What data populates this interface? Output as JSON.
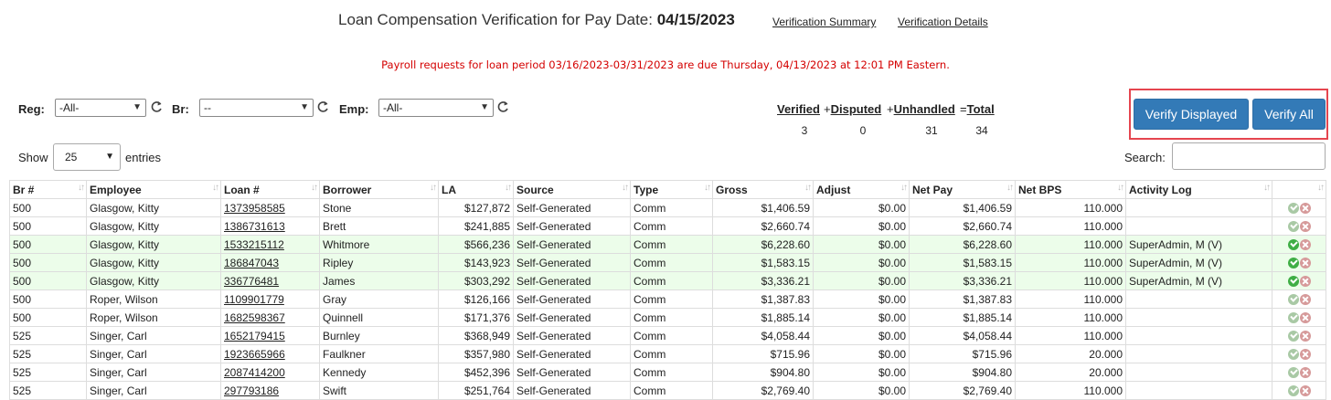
{
  "header": {
    "title_prefix": "Loan Compensation Verification for Pay Date: ",
    "pay_date": "04/15/2023",
    "link_summary": "Verification Summary",
    "link_details": "Verification Details"
  },
  "notice": "Payroll requests for loan period 03/16/2023-03/31/2023 are due Thursday, 04/13/2023 at 12:01 PM Eastern.",
  "filters": {
    "reg_label": "Reg:",
    "reg_value": "-All-",
    "br_label": "Br:",
    "br_value": "--",
    "emp_label": "Emp:",
    "emp_value": "-All-"
  },
  "stats": {
    "verified_label": "Verified",
    "disputed_prefix": "+",
    "disputed_label": "Disputed",
    "unhandled_prefix": "+",
    "unhandled_label": "Unhandled",
    "total_prefix": "=",
    "total_label": "Total",
    "verified": "3",
    "disputed": "0",
    "unhandled": "31",
    "total": "34"
  },
  "buttons": {
    "verify_displayed": "Verify Displayed",
    "verify_all": "Verify All"
  },
  "table_controls": {
    "show": "Show",
    "page_length": "25",
    "entries": "entries",
    "search_label": "Search:"
  },
  "columns": [
    "Br #",
    "Employee",
    "Loan #",
    "Borrower",
    "LA",
    "Source",
    "Type",
    "Gross",
    "Adjust",
    "Net Pay",
    "Net BPS",
    "Activity Log",
    ""
  ],
  "rows": [
    {
      "br": "500",
      "employee": "Glasgow, Kitty",
      "loan": "1373958585",
      "borrower": "Stone",
      "la": "$127,872",
      "source": "Self-Generated",
      "type": "Comm",
      "gross": "$1,406.59",
      "adjust": "$0.00",
      "net": "$1,406.59",
      "bps": "110.000",
      "log": "",
      "verified": false
    },
    {
      "br": "500",
      "employee": "Glasgow, Kitty",
      "loan": "1386731613",
      "borrower": "Brett",
      "la": "$241,885",
      "source": "Self-Generated",
      "type": "Comm",
      "gross": "$2,660.74",
      "adjust": "$0.00",
      "net": "$2,660.74",
      "bps": "110.000",
      "log": "",
      "verified": false
    },
    {
      "br": "500",
      "employee": "Glasgow, Kitty",
      "loan": "1533215112",
      "borrower": "Whitmore",
      "la": "$566,236",
      "source": "Self-Generated",
      "type": "Comm",
      "gross": "$6,228.60",
      "adjust": "$0.00",
      "net": "$6,228.60",
      "bps": "110.000",
      "log": "SuperAdmin, M (V)",
      "verified": true
    },
    {
      "br": "500",
      "employee": "Glasgow, Kitty",
      "loan": "186847043",
      "borrower": "Ripley",
      "la": "$143,923",
      "source": "Self-Generated",
      "type": "Comm",
      "gross": "$1,583.15",
      "adjust": "$0.00",
      "net": "$1,583.15",
      "bps": "110.000",
      "log": "SuperAdmin, M (V)",
      "verified": true
    },
    {
      "br": "500",
      "employee": "Glasgow, Kitty",
      "loan": "336776481",
      "borrower": "James",
      "la": "$303,292",
      "source": "Self-Generated",
      "type": "Comm",
      "gross": "$3,336.21",
      "adjust": "$0.00",
      "net": "$3,336.21",
      "bps": "110.000",
      "log": "SuperAdmin, M (V)",
      "verified": true
    },
    {
      "br": "500",
      "employee": "Roper, Wilson",
      "loan": "1109901779",
      "borrower": "Gray",
      "la": "$126,166",
      "source": "Self-Generated",
      "type": "Comm",
      "gross": "$1,387.83",
      "adjust": "$0.00",
      "net": "$1,387.83",
      "bps": "110.000",
      "log": "",
      "verified": false
    },
    {
      "br": "500",
      "employee": "Roper, Wilson",
      "loan": "1682598367",
      "borrower": "Quinnell",
      "la": "$171,376",
      "source": "Self-Generated",
      "type": "Comm",
      "gross": "$1,885.14",
      "adjust": "$0.00",
      "net": "$1,885.14",
      "bps": "110.000",
      "log": "",
      "verified": false
    },
    {
      "br": "525",
      "employee": "Singer, Carl",
      "loan": "1652179415",
      "borrower": "Burnley",
      "la": "$368,949",
      "source": "Self-Generated",
      "type": "Comm",
      "gross": "$4,058.44",
      "adjust": "$0.00",
      "net": "$4,058.44",
      "bps": "110.000",
      "log": "",
      "verified": false
    },
    {
      "br": "525",
      "employee": "Singer, Carl",
      "loan": "1923665966",
      "borrower": "Faulkner",
      "la": "$357,980",
      "source": "Self-Generated",
      "type": "Comm",
      "gross": "$715.96",
      "adjust": "$0.00",
      "net": "$715.96",
      "bps": "20.000",
      "log": "",
      "verified": false
    },
    {
      "br": "525",
      "employee": "Singer, Carl",
      "loan": "2087414200",
      "borrower": "Kennedy",
      "la": "$452,396",
      "source": "Self-Generated",
      "type": "Comm",
      "gross": "$904.80",
      "adjust": "$0.00",
      "net": "$904.80",
      "bps": "20.000",
      "log": "",
      "verified": false
    },
    {
      "br": "525",
      "employee": "Singer, Carl",
      "loan": "297793186",
      "borrower": "Swift",
      "la": "$251,764",
      "source": "Self-Generated",
      "type": "Comm",
      "gross": "$2,769.40",
      "adjust": "$0.00",
      "net": "$2,769.40",
      "bps": "110.000",
      "log": "",
      "verified": false
    }
  ]
}
